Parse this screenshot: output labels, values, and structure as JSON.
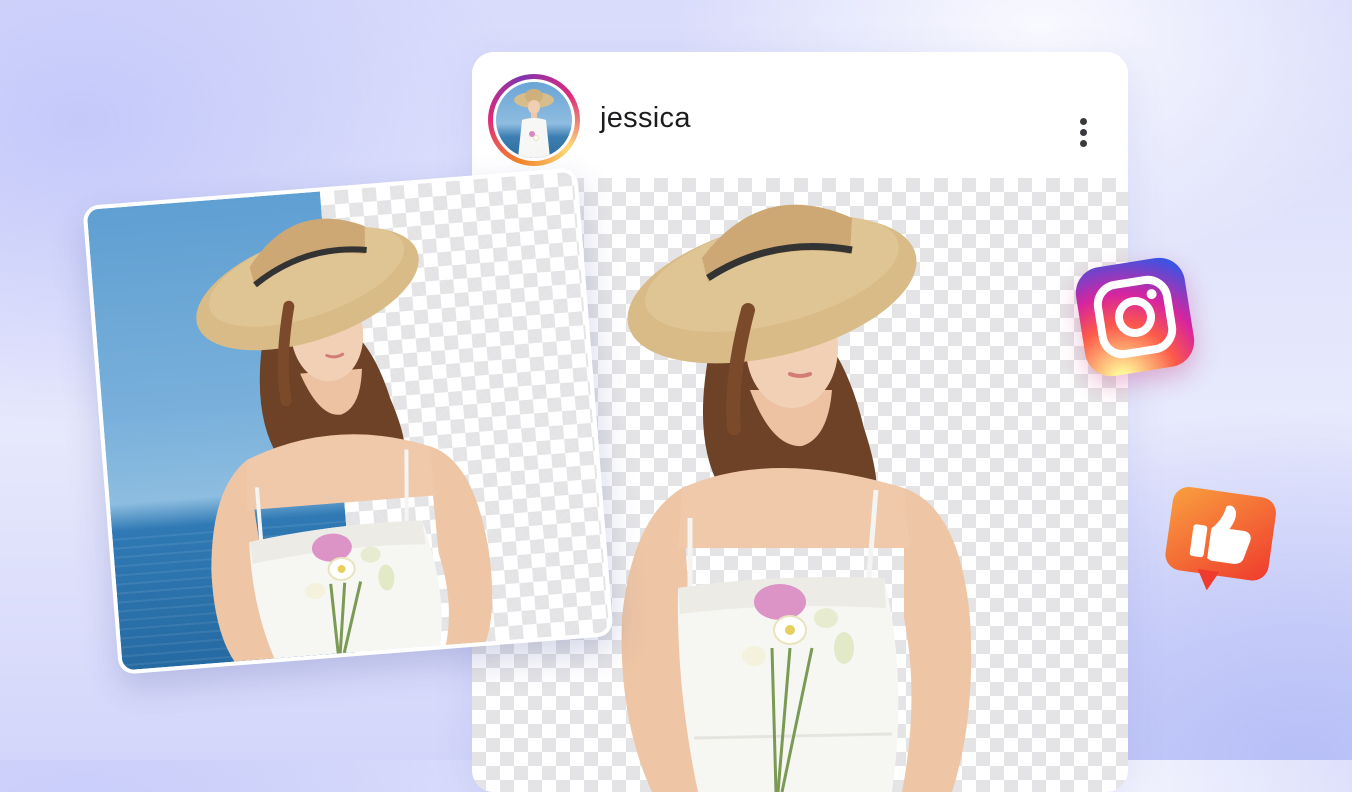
{
  "post": {
    "username": "jessica"
  },
  "icons": {
    "menu": "more-vertical-icon",
    "instagram": "instagram-icon",
    "like": "thumbs-up-icon"
  },
  "colors": {
    "instagram_gradient": [
      "#feda75",
      "#fa7e1e",
      "#d62976",
      "#962fbf",
      "#4f5bd5"
    ],
    "like_gradient": [
      "#f9a03f",
      "#ef3b2d"
    ]
  }
}
